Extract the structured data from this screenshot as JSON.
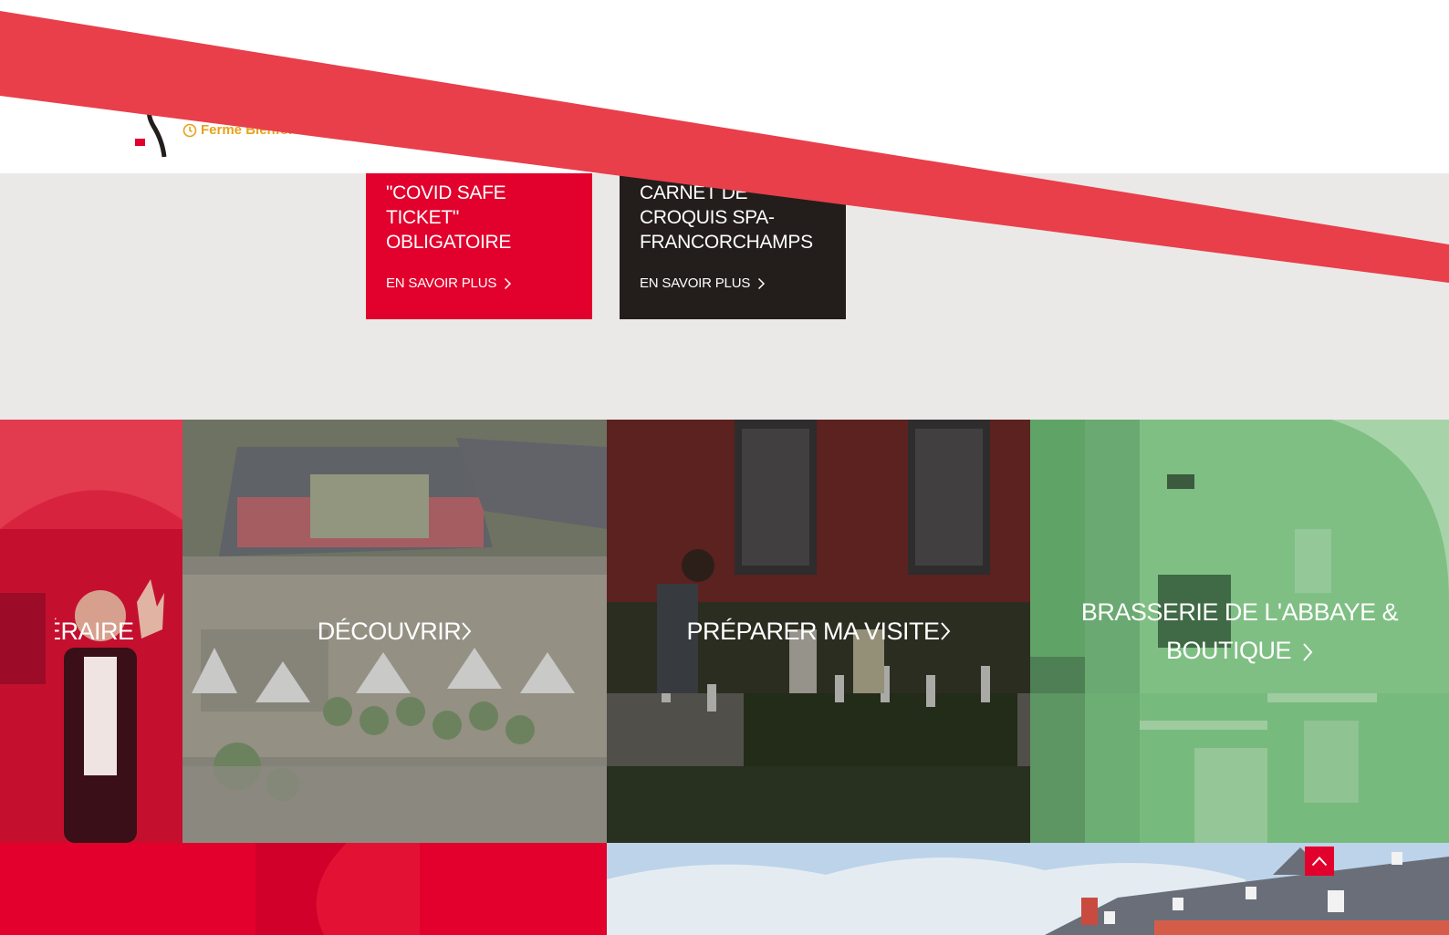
{
  "header": {
    "hours_text": "Ferme Bienfor",
    "logo_icon": "abbey-logo",
    "clock_icon": "clock-icon"
  },
  "news": [
    {
      "title": "\"COVID SAFE\nTICKET\"\nOBLIGATOIRE",
      "more": "EN SAVOIR PLUS"
    },
    {
      "title": "CARNET DE\nCROQUIS SPA-\nFRANCORCHAMPS",
      "more": "EN SAVOIR PLUS"
    }
  ],
  "tiles": [
    {
      "label": "ITINÉRAIRE"
    },
    {
      "label": "DÉCOUVRIR"
    },
    {
      "label": "PRÉPARER MA VISITE"
    },
    {
      "label": "BRASSERIE DE L'ABBAYE & BOUTIQUE"
    }
  ],
  "colors": {
    "brand_red": "#e2002c",
    "banner_red": "#e83f4b",
    "dark": "#231d1b",
    "accent_orange": "#e8a21a",
    "background": "#ebe9e7",
    "green_overlay": "#5fb46a"
  }
}
